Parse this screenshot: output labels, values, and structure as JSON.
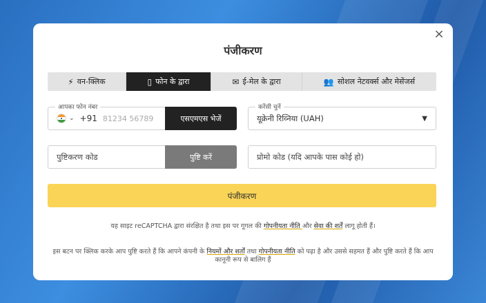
{
  "modal": {
    "title": "पंजीकरण",
    "close_label": "×"
  },
  "tabs": [
    {
      "label": "वन-क्लिक",
      "icon": "lightning-icon",
      "active": false
    },
    {
      "label": "फोन के द्वारा",
      "icon": "phone-icon",
      "active": true
    },
    {
      "label": "ई-मेल के द्वारा",
      "icon": "envelope-icon",
      "active": false
    },
    {
      "label": "सोशल नेटवर्क्स और मेसेंजर्स",
      "icon": "users-icon",
      "active": false
    }
  ],
  "phone": {
    "label": "आपका फोन नंबर",
    "country_code": "+91",
    "placeholder": "81234 56789",
    "sms_button": "एसएमएस भेजें"
  },
  "currency": {
    "label": "करेंसी चुनें",
    "value": "यूक्रेनी रिव्निया (UAH)"
  },
  "confirmation": {
    "placeholder": "पुष्टिकरण कोड",
    "button": "पुष्टि करें"
  },
  "promo": {
    "placeholder": "प्रोमो कोड (यदि आपके पास कोई हो)"
  },
  "register_button": "पंजीकरण",
  "recaptcha_note": {
    "pre": "यह साइट reCAPTCHA द्वारा संरक्षित है तथा इस पर गूगल की ",
    "privacy_link": "गोपनीयता नीति ",
    "mid": "और ",
    "terms_link": "सेवा की शर्तें",
    "post": " लागू होती हैं।"
  },
  "consent_note": {
    "pre": "इस बटन पर क्लिक करके आप पुष्टि करते हैं कि आपने कंपनी के ",
    "terms_link": "नियमों और शर्तों",
    "mid": " तथा ",
    "privacy_link": "गोपनीयता नीति",
    "post": " को पढ़ा है और उससे सहमत हैं और पुष्टि करते हैं कि आप कानूनी रूप से बालिग हैं"
  }
}
